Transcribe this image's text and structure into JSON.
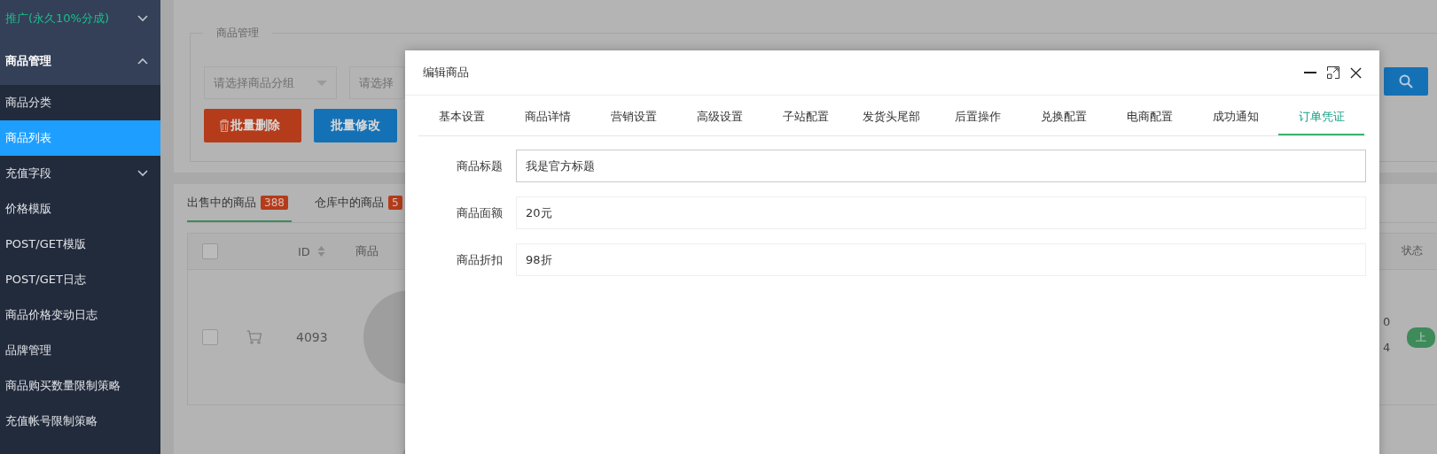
{
  "sidebar": [
    {
      "label": "推广(永久10%分成)",
      "kind": "promo",
      "expanded": false
    },
    {
      "label": "商品管理",
      "kind": "group",
      "expanded": true,
      "children": [
        {
          "label": "商品分类",
          "kind": "link",
          "selected": false
        },
        {
          "label": "商品列表",
          "kind": "link",
          "selected": true
        },
        {
          "label": "充值字段",
          "kind": "submenu",
          "selected": false,
          "expanded": false
        },
        {
          "label": "价格模版",
          "kind": "link",
          "selected": false
        },
        {
          "label": "POST/GET模版",
          "kind": "link",
          "selected": false
        },
        {
          "label": "POST/GET日志",
          "kind": "link",
          "selected": false
        },
        {
          "label": "商品价格变动日志",
          "kind": "link",
          "selected": false
        },
        {
          "label": "品牌管理",
          "kind": "link",
          "selected": false
        },
        {
          "label": "商品购买数量限制策略",
          "kind": "link",
          "selected": false
        },
        {
          "label": "充值帐号限制策略",
          "kind": "link",
          "selected": false
        }
      ]
    }
  ],
  "page": {
    "panel_title": "商品管理",
    "selects": [
      {
        "placeholder": "请选择商品分组",
        "kind": "dropdown"
      },
      {
        "placeholder": "请选择",
        "kind": "plain"
      }
    ],
    "buttons": [
      {
        "label": "批量删除",
        "kind": "danger"
      },
      {
        "label": "批量修改",
        "kind": "primary"
      }
    ],
    "tabs": [
      {
        "label": "出售中的商品",
        "badge": "388",
        "selected": true
      },
      {
        "label": "仓库中的商品",
        "badge": "5",
        "selected": false
      }
    ],
    "table": {
      "all_checked": false,
      "columns": [
        "ID",
        "商品"
      ],
      "rows": [
        {
          "checked": false,
          "id": "4093"
        }
      ],
      "status_column": "状态",
      "values": [
        "0",
        "4"
      ],
      "status_badge": "上"
    }
  },
  "modal": {
    "title": "编辑商品",
    "tabs": [
      {
        "label": "基本设置",
        "selected": false
      },
      {
        "label": "商品详情",
        "selected": false
      },
      {
        "label": "营销设置",
        "selected": false
      },
      {
        "label": "高级设置",
        "selected": false
      },
      {
        "label": "子站配置",
        "selected": false
      },
      {
        "label": "发货头尾部",
        "selected": false
      },
      {
        "label": "后置操作",
        "selected": false
      },
      {
        "label": "兑换配置",
        "selected": false
      },
      {
        "label": "电商配置",
        "selected": false
      },
      {
        "label": "成功通知",
        "selected": false
      },
      {
        "label": "订单凭证",
        "selected": true
      }
    ],
    "fields": [
      {
        "label": "商品标题",
        "value": "我是官方标题",
        "focused": true
      },
      {
        "label": "商品面额",
        "value": "20元",
        "focused": false
      },
      {
        "label": "商品折扣",
        "value": "98折",
        "focused": false
      }
    ]
  }
}
